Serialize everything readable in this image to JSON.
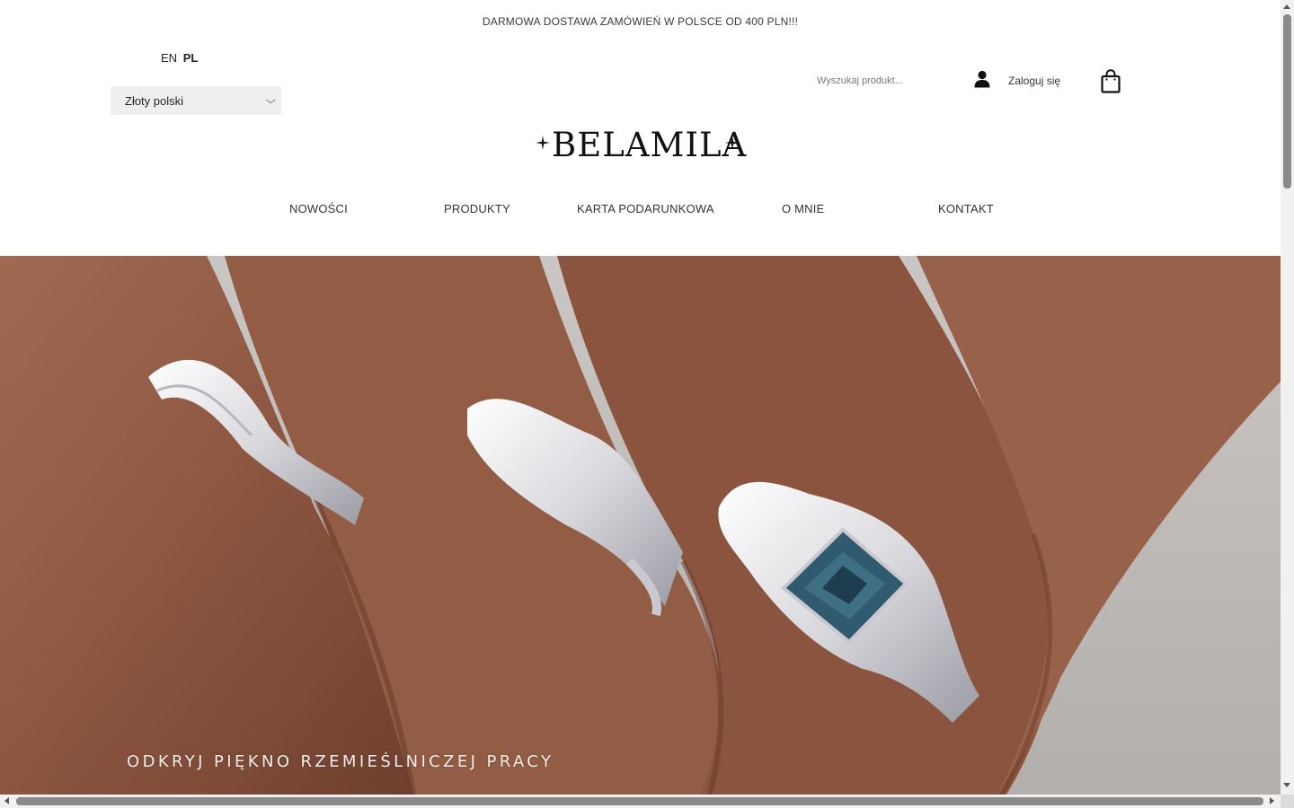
{
  "promo": {
    "text": "DARMOWA DOSTAWA ZAMÓWIEŃ W POLSCE OD 400 PLN!!!"
  },
  "language": {
    "en": "EN",
    "pl": "PL",
    "active": "PL"
  },
  "currency": {
    "selected": "Złoty polski"
  },
  "search": {
    "placeholder": "Wyszukaj produkt..."
  },
  "account": {
    "login_label": "Zaloguj się",
    "icon": "user-icon"
  },
  "cart": {
    "icon": "shopping-bag-icon"
  },
  "logo": {
    "text": "BELAMILA"
  },
  "nav": {
    "items": [
      {
        "label": "NOWOŚCI"
      },
      {
        "label": "PRODUKTY"
      },
      {
        "label": "KARTA PODARUNKOWA"
      },
      {
        "label": "O MNIE"
      },
      {
        "label": "KONTAKT"
      }
    ]
  },
  "hero": {
    "tagline": "ODKRYJ PIĘKNO RZEMIEŚLNICZEJ PRACY"
  },
  "colors": {
    "text": "#2b2b2b",
    "hero_skin": "#8f5a42",
    "gem": "#3e6f85"
  }
}
